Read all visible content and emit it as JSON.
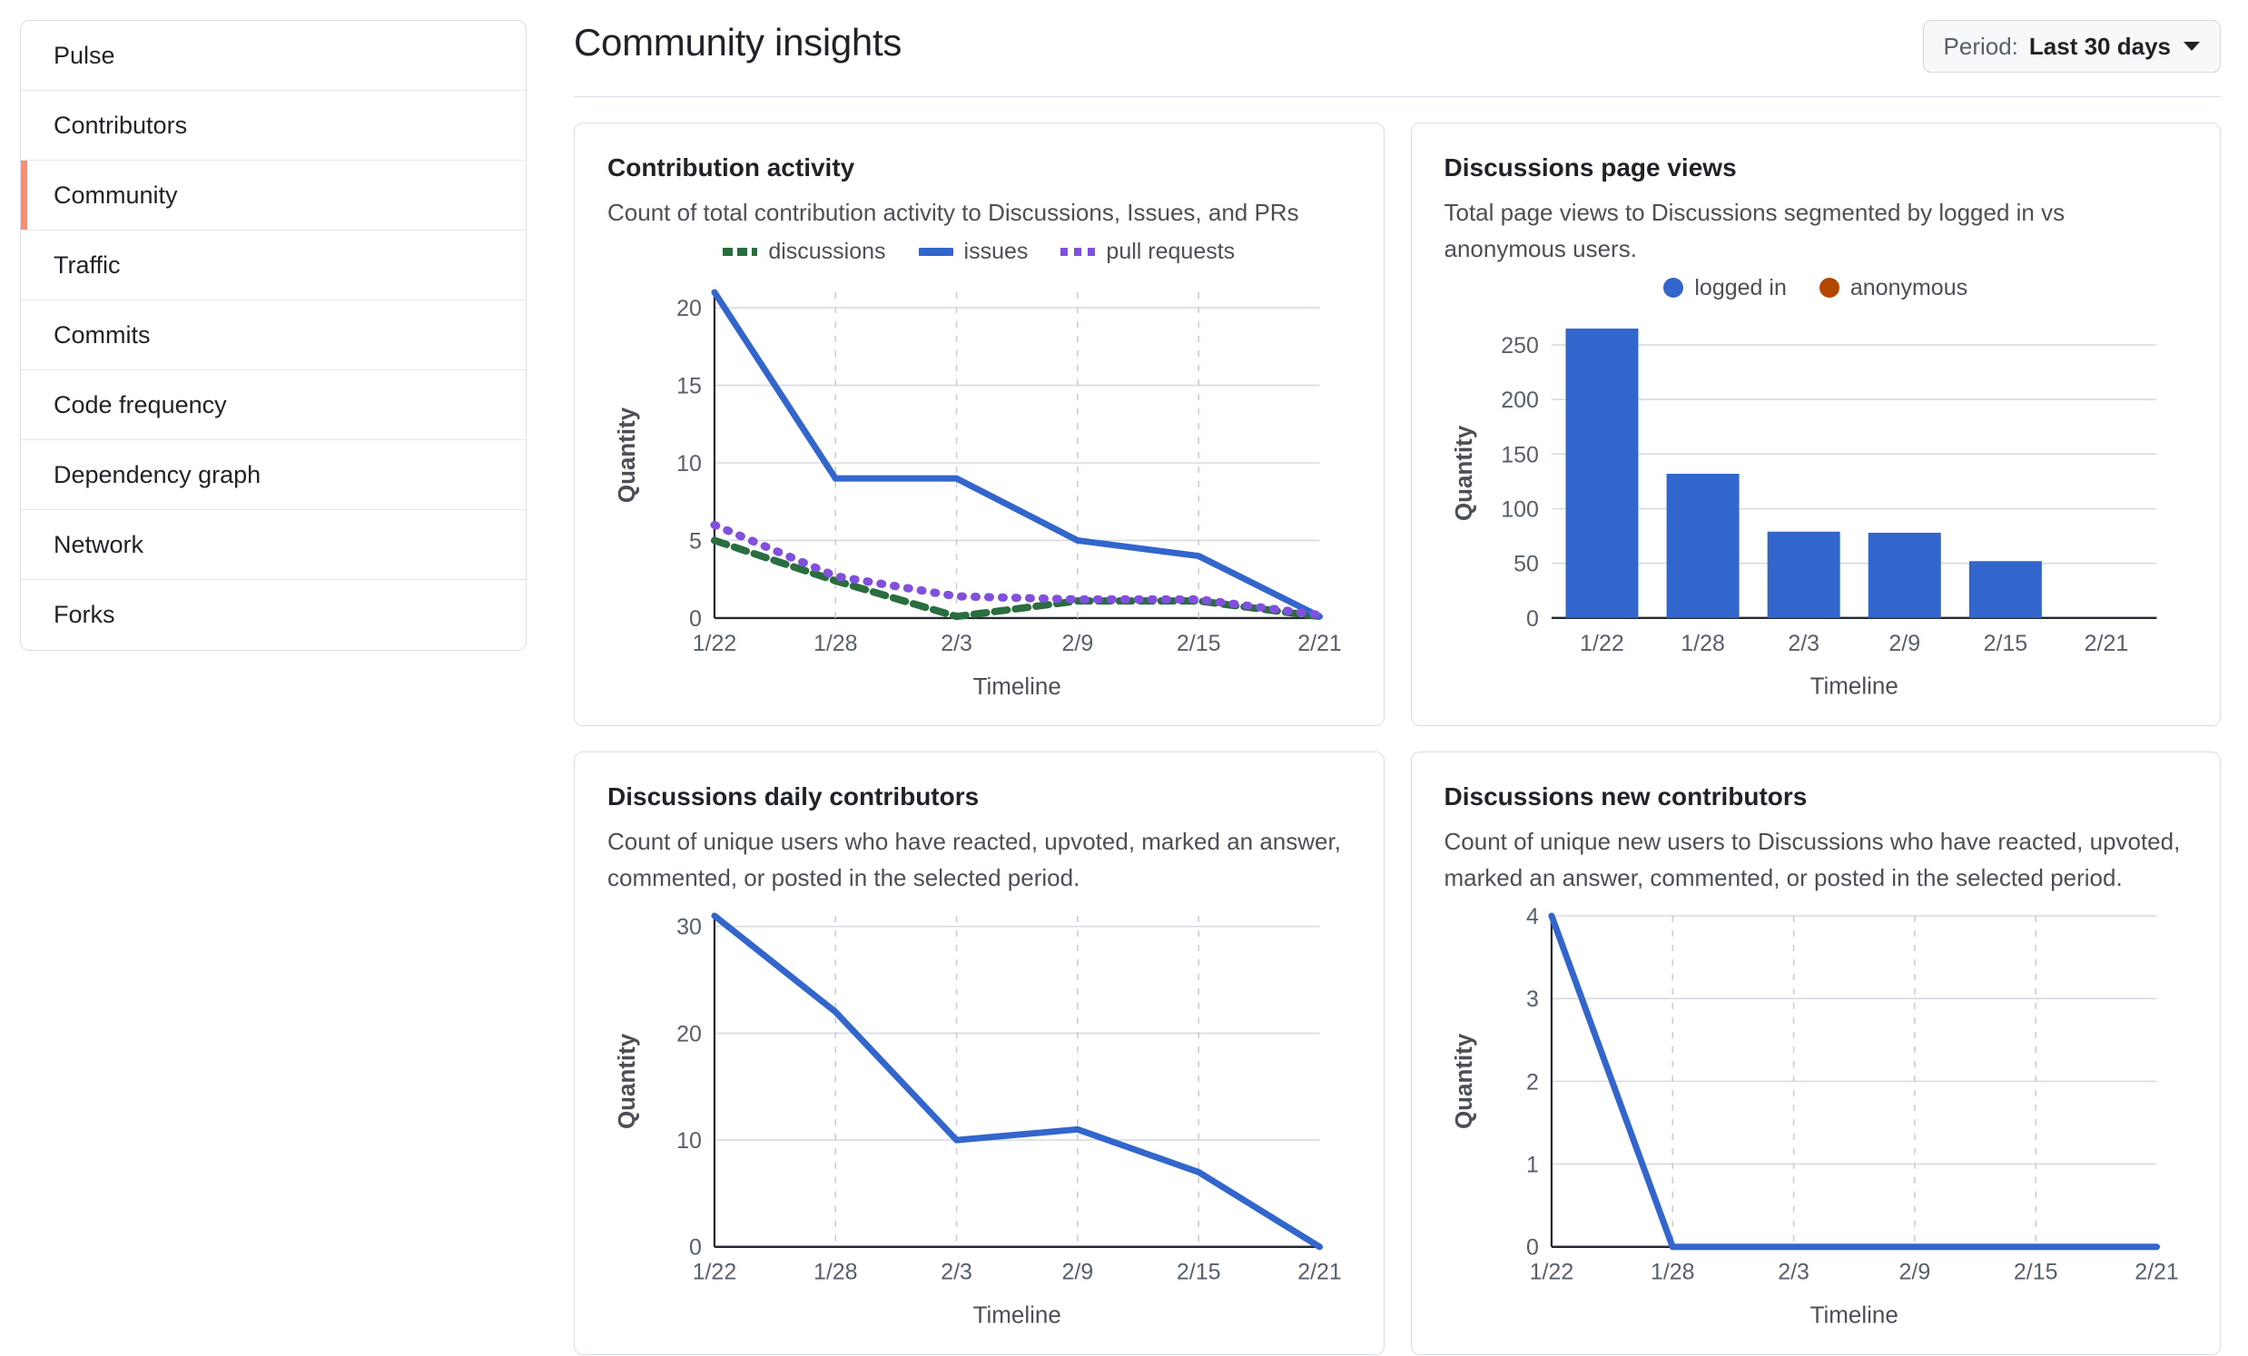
{
  "sidebar": {
    "items": [
      {
        "label": "Pulse",
        "active": false
      },
      {
        "label": "Contributors",
        "active": false
      },
      {
        "label": "Community",
        "active": true
      },
      {
        "label": "Traffic",
        "active": false
      },
      {
        "label": "Commits",
        "active": false
      },
      {
        "label": "Code frequency",
        "active": false
      },
      {
        "label": "Dependency graph",
        "active": false
      },
      {
        "label": "Network",
        "active": false
      },
      {
        "label": "Forks",
        "active": false
      }
    ],
    "active_indicator_color": "#fd8c73"
  },
  "header": {
    "title": "Community insights",
    "period_label": "Period:",
    "period_value": "Last 30 days",
    "caret_icon": "chevron-down-icon"
  },
  "cards": [
    {
      "title": "Contribution activity",
      "description": "Count of total contribution activity to Discussions, Issues, and PRs"
    },
    {
      "title": "Discussions page views",
      "description": "Total page views to Discussions segmented by logged in vs anonymous users."
    },
    {
      "title": "Discussions daily contributors",
      "description": "Count of unique users who have reacted, upvoted, marked an answer, commented, or posted in the selected period."
    },
    {
      "title": "Discussions new contributors",
      "description": "Count of unique new users to Discussions who have reacted, upvoted, marked an answer, commented, or posted in the selected period."
    }
  ],
  "chart_data": [
    {
      "id": "contribution-activity",
      "type": "line",
      "title": "Contribution activity",
      "xlabel": "Timeline",
      "ylabel": "Quantity",
      "categories": [
        "1/22",
        "1/28",
        "2/3",
        "2/9",
        "2/15",
        "2/21"
      ],
      "x": [
        0,
        1,
        2,
        3,
        4,
        5
      ],
      "ylim": [
        0,
        21
      ],
      "yticks": [
        0,
        5,
        10,
        15,
        20
      ],
      "grid": true,
      "legend_position": "top",
      "series": [
        {
          "name": "discussions",
          "values": [
            5,
            2.4,
            0.1,
            1.1,
            1.1,
            0.1
          ],
          "color": "#2a6e3f",
          "style": "dashed"
        },
        {
          "name": "issues",
          "values": [
            21,
            9,
            9,
            5,
            4,
            0.1
          ],
          "color": "#3366cc",
          "style": "solid"
        },
        {
          "name": "pull requests",
          "values": [
            6,
            2.7,
            1.4,
            1.2,
            1.2,
            0.2
          ],
          "color": "#8250df",
          "style": "dotted"
        }
      ]
    },
    {
      "id": "discussions-page-views",
      "type": "bar",
      "title": "Discussions page views",
      "xlabel": "Timeline",
      "ylabel": "Quantity",
      "categories": [
        "1/22",
        "1/28",
        "2/3",
        "2/9",
        "2/15",
        "2/21"
      ],
      "ylim": [
        0,
        265
      ],
      "yticks": [
        0,
        50,
        100,
        150,
        200,
        250
      ],
      "grid": true,
      "legend_position": "top",
      "series": [
        {
          "name": "logged in",
          "values": [
            265,
            132,
            79,
            78,
            52,
            0
          ],
          "color": "#3366cc"
        },
        {
          "name": "anonymous",
          "values": [
            0,
            0,
            0,
            0,
            0,
            0
          ],
          "color": "#b34700"
        }
      ]
    },
    {
      "id": "discussions-daily-contributors",
      "type": "line",
      "title": "Discussions daily contributors",
      "xlabel": "Timeline",
      "ylabel": "Quantity",
      "categories": [
        "1/22",
        "1/28",
        "2/3",
        "2/9",
        "2/15",
        "2/21"
      ],
      "ylim": [
        0,
        31
      ],
      "yticks": [
        0,
        10,
        20,
        30
      ],
      "grid": true,
      "legend_position": "none",
      "series": [
        {
          "name": "contributors",
          "values": [
            31,
            22,
            10,
            11,
            7,
            0
          ],
          "color": "#3366cc",
          "style": "solid"
        }
      ]
    },
    {
      "id": "discussions-new-contributors",
      "type": "line",
      "title": "Discussions new contributors",
      "xlabel": "Timeline",
      "ylabel": "Quantity",
      "categories": [
        "1/22",
        "1/28",
        "2/3",
        "2/9",
        "2/15",
        "2/21"
      ],
      "ylim": [
        0,
        4
      ],
      "yticks": [
        0,
        1,
        2,
        3,
        4
      ],
      "grid": true,
      "legend_position": "none",
      "series": [
        {
          "name": "new contributors",
          "values": [
            4,
            0,
            0,
            0,
            0,
            0
          ],
          "color": "#3366cc",
          "style": "solid"
        }
      ]
    }
  ]
}
